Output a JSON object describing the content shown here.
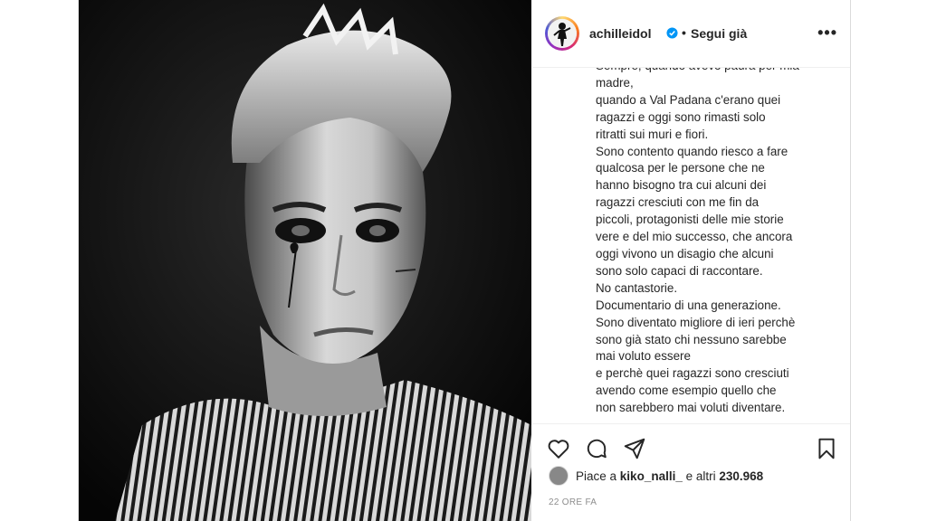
{
  "post": {
    "username": "achilleidol",
    "verified": true,
    "follow_label": "Segui già",
    "more_icon": "more-horizontal-icon",
    "caption_lines": [
      "Sempre, quando avevo paura per mia",
      "madre,",
      "quando a Val Padana c'erano quei",
      "ragazzi e oggi sono rimasti solo",
      "ritratti sui muri e fiori.",
      "Sono contento quando riesco a fare",
      "qualcosa per le persone che ne",
      "hanno bisogno tra cui alcuni dei",
      "ragazzi cresciuti con me fin da",
      "piccoli, protagonisti delle mie storie",
      "vere e del mio successo, che ancora",
      "oggi vivono un disagio che alcuni",
      "sono solo capaci di raccontare.",
      "No cantastorie.",
      "Documentario di una generazione.",
      "Sono diventato migliore di ieri perchè",
      "sono già stato chi nessuno sarebbe",
      "mai voluto essere",
      "e perchè quei ragazzi sono cresciuti",
      "avendo come esempio quello che",
      "non sarebbero mai voluti diventare."
    ],
    "likes": {
      "prefix": "Piace a",
      "user": "kiko_nalli_",
      "middle": "e altri",
      "count": "230.968"
    },
    "timestamp": "22 ORE FA"
  },
  "icons": [
    "heart-icon",
    "comment-icon",
    "share-icon",
    "bookmark-icon",
    "verified-badge-icon"
  ],
  "colors": {
    "accent": "#0095f6",
    "text": "#262626",
    "muted": "#8e8e8e",
    "border": "#dbdbdb"
  }
}
